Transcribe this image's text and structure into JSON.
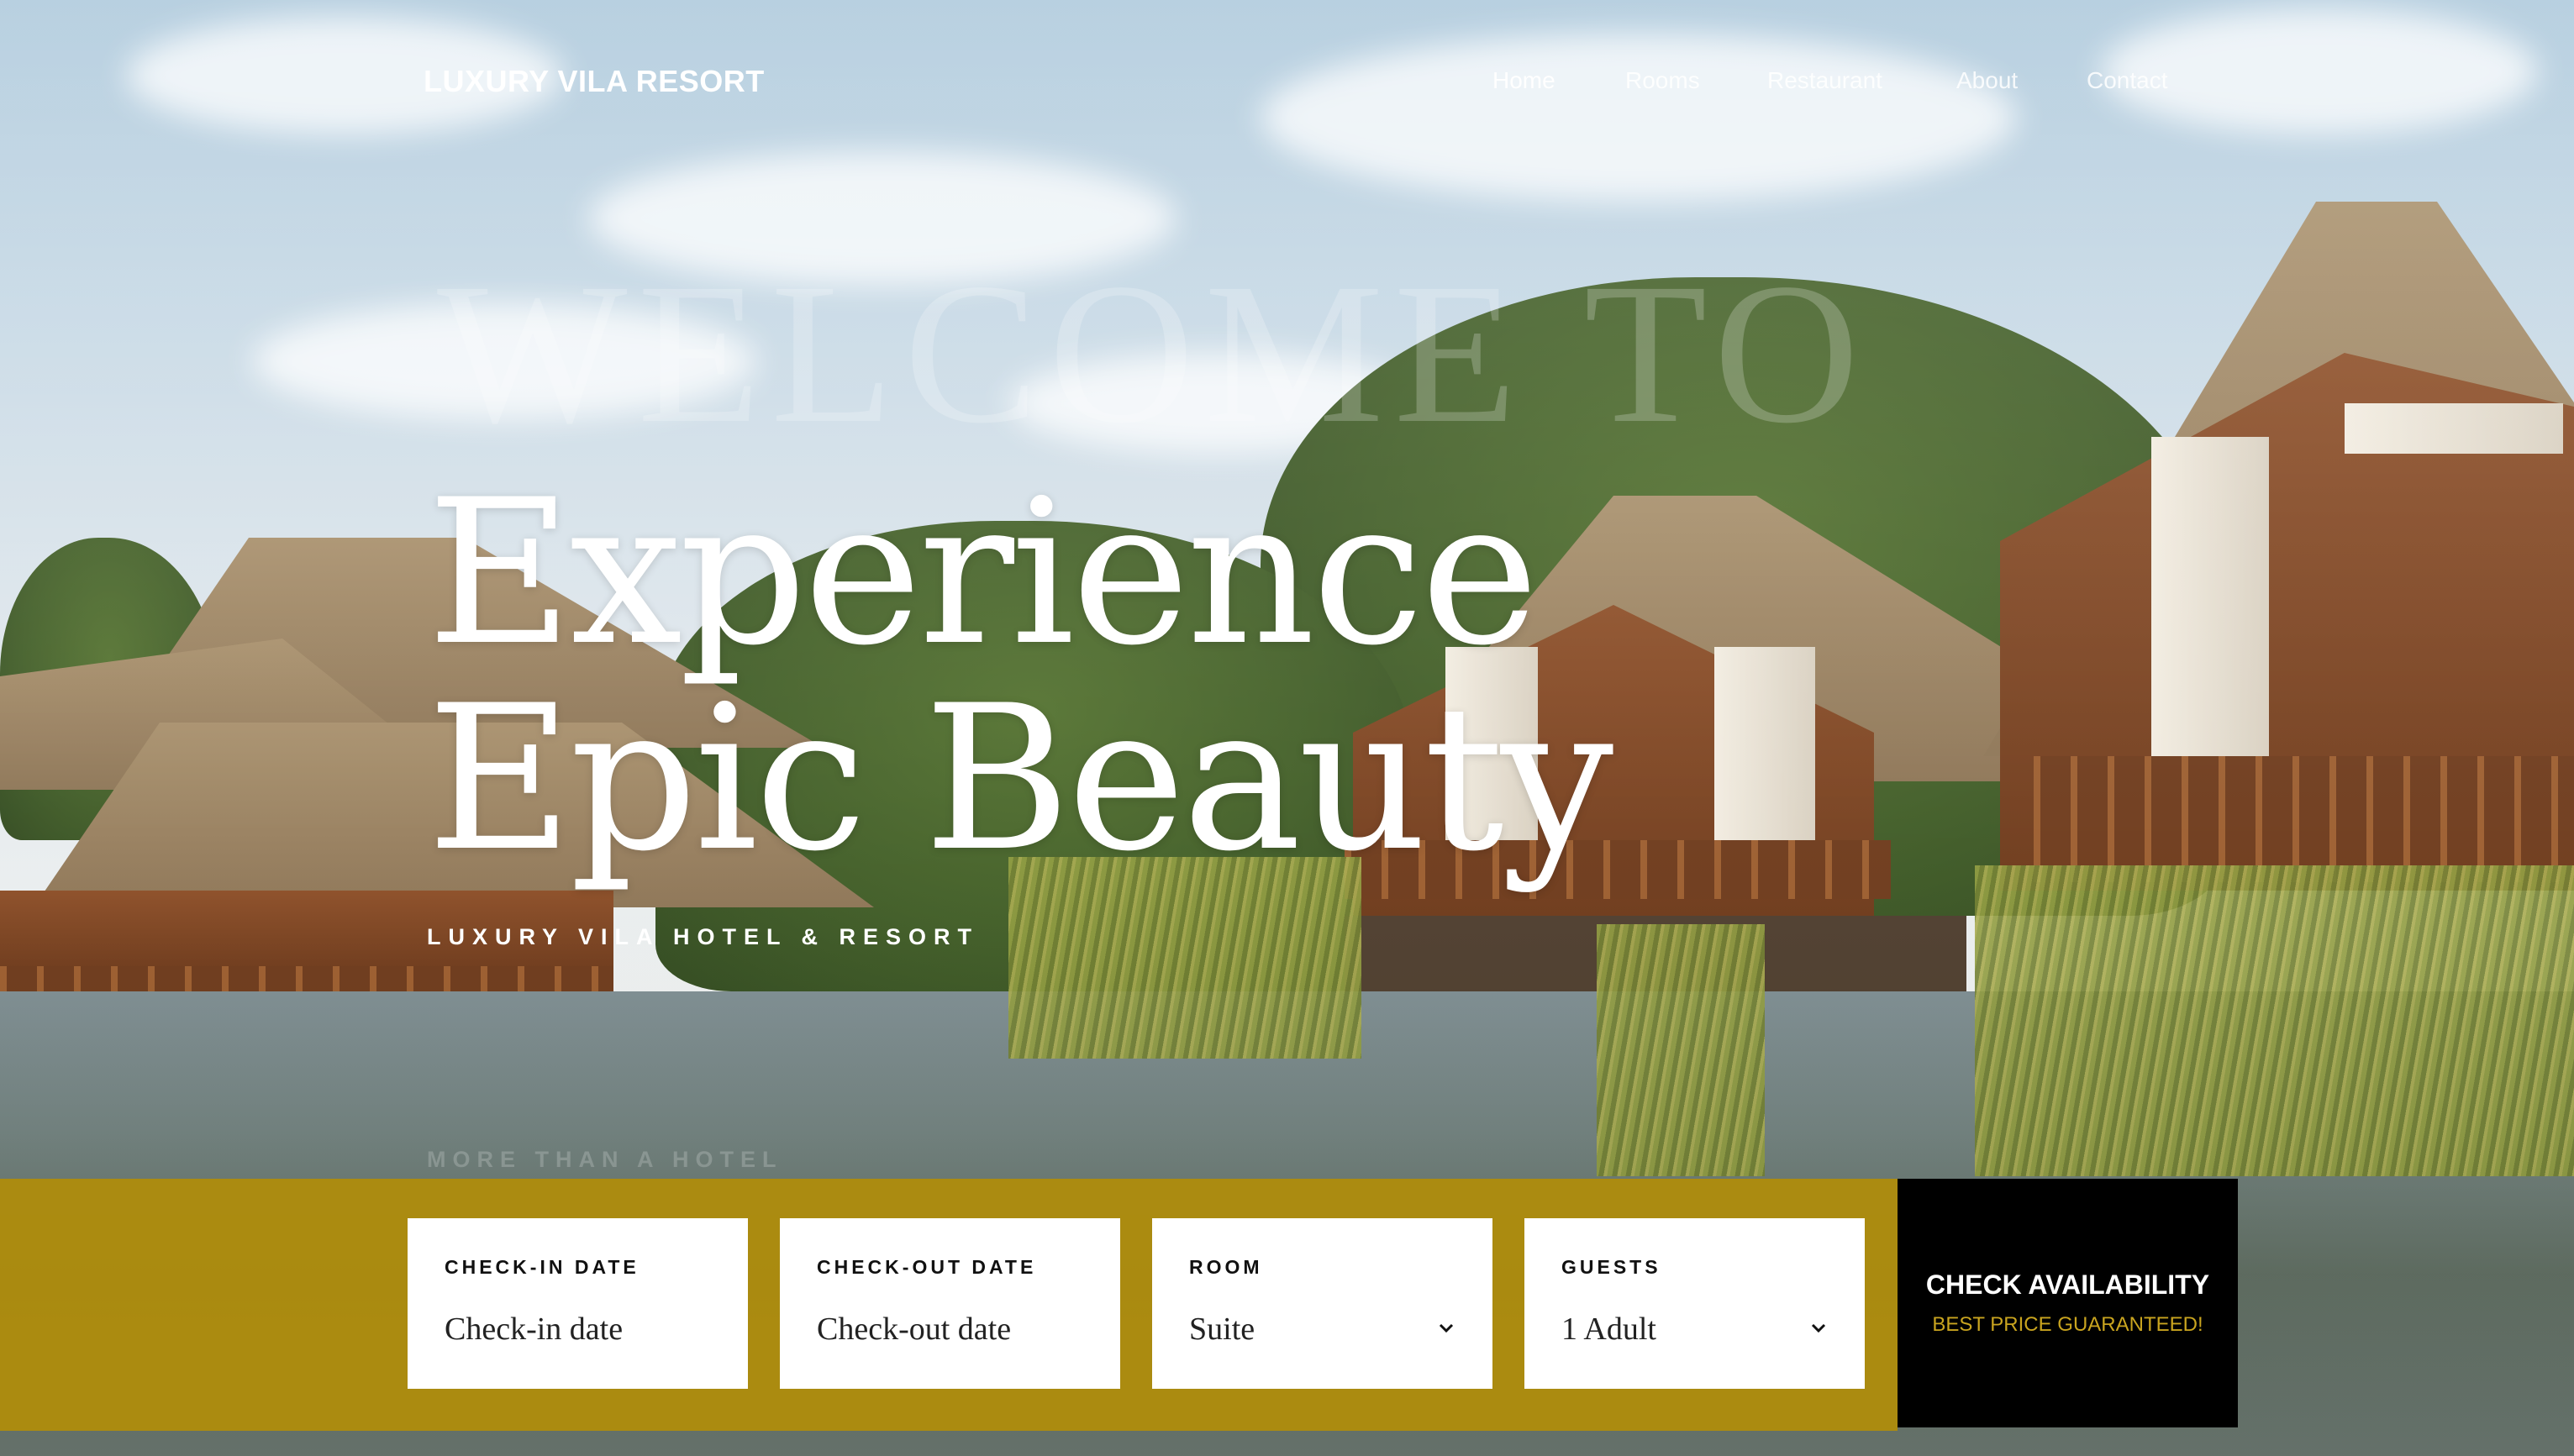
{
  "header": {
    "brand": "LUXURY VILA RESORT",
    "nav": [
      {
        "label": "Home",
        "active": true
      },
      {
        "label": "Rooms",
        "active": false
      },
      {
        "label": "Restaurant",
        "active": false
      },
      {
        "label": "About",
        "active": false
      },
      {
        "label": "Contact",
        "active": false
      }
    ]
  },
  "hero": {
    "ghost_text": "WELCOME TO",
    "title_line1": "Experience",
    "title_line2": "Epic Beauty",
    "subtitle": "LUXURY VILA HOTEL & RESORT",
    "ghost_subtitle": "MORE THAN A HOTEL"
  },
  "booking": {
    "checkin": {
      "label": "CHECK-IN DATE",
      "placeholder": "Check-in date"
    },
    "checkout": {
      "label": "CHECK-OUT DATE",
      "placeholder": "Check-out date"
    },
    "room": {
      "label": "ROOM",
      "value": "Suite"
    },
    "guests": {
      "label": "GUESTS",
      "value": "1 Adult"
    },
    "cta": {
      "title": "CHECK AVAILABILITY",
      "subtitle": "BEST PRICE GUARANTEED!"
    }
  },
  "colors": {
    "booking_bar": "#b08d0a",
    "cta_background": "#000000",
    "cta_accent": "#c9a41f"
  },
  "icons": {
    "select_caret": "chevron-down-icon"
  }
}
